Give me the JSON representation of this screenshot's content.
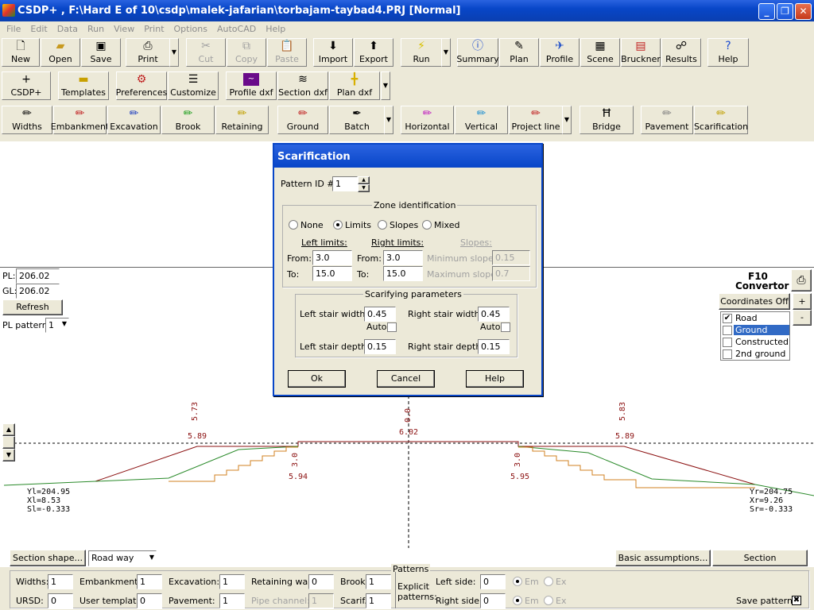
{
  "window": {
    "title": "CSDP+ , F:\\Hard E of 10\\csdp\\malek-jafarian\\torbajam-taybad4.PRJ [Normal]",
    "min": "_",
    "max": "❐",
    "close": "✕"
  },
  "menu": [
    "File",
    "Edit",
    "Data",
    "Run",
    "View",
    "Print",
    "Options",
    "AutoCAD",
    "Help"
  ],
  "toolbar1": {
    "new": "New",
    "open": "Open",
    "save": "Save",
    "print": "Print",
    "cut": "Cut",
    "copy": "Copy",
    "paste": "Paste",
    "import": "Import",
    "export": "Export",
    "run": "Run",
    "summary": "Summary",
    "plan": "Plan",
    "profile": "Profile",
    "scene": "Scene",
    "bruckner": "Bruckner",
    "results": "Results",
    "help": "Help"
  },
  "toolbar2": {
    "csdp": "CSDP+",
    "templates": "Templates",
    "preferences": "Preferences",
    "customize": "Customize",
    "profile_dxf": "Profile dxf",
    "section_dxf": "Section dxf",
    "plan_dxf": "Plan dxf"
  },
  "toolbar3": {
    "widths": "Widths",
    "embankment": "Embankment",
    "excavation": "Excavation",
    "brook": "Brook",
    "retaining": "Retaining",
    "ground": "Ground",
    "batch": "Batch",
    "horizontal": "Horizontal",
    "vertical": "Vertical",
    "project_line": "Project line",
    "bridge": "Bridge",
    "pavement": "Pavement",
    "scarification": "Scarification"
  },
  "leftpanel": {
    "pl_label": "PL:",
    "pl_value": "206.02",
    "gl_label": "GL:",
    "gl_value": "206.02",
    "refresh": "Refresh",
    "pl_pattern_label": "PL pattern:",
    "pl_pattern_value": "1"
  },
  "rightpanel": {
    "f10": "F10",
    "convertor": "Convertor",
    "coords": "Coordinates Off",
    "plus": "+",
    "minus": "-",
    "layers": [
      {
        "label": "Road",
        "checked": true
      },
      {
        "label": "Ground",
        "checked": false
      },
      {
        "label": "Constructed",
        "checked": false
      },
      {
        "label": "2nd ground",
        "checked": false
      }
    ]
  },
  "section": {
    "labels": {
      "l_top": "5.73",
      "l_bot": "5.89",
      "c_top": "0.0",
      "c_bot": "6.02",
      "r_top": "5.83",
      "r_bot": "5.89",
      "l_slope": "3.0",
      "l_slope_v": "5.94",
      "r_slope": "3.0",
      "r_slope_v": "5.95"
    },
    "left_info": [
      "Yl=204.95",
      "Xl=8.53",
      "Sl=-0.333"
    ],
    "right_info": [
      "Yr=204.75",
      "Xr=9.26",
      "Sr=-0.333"
    ]
  },
  "dialog": {
    "title": "Scarification",
    "pattern_label": "Pattern ID #",
    "pattern_value": "1",
    "zone_title": "Zone identification",
    "radios": [
      "None",
      "Limits",
      "Slopes",
      "Mixed"
    ],
    "left_limits": "Left limits:",
    "right_limits": "Right limits:",
    "slopes": "Slopes:",
    "from": "From:",
    "to": "To:",
    "left_from": "3.0",
    "left_to": "15.0",
    "right_from": "3.0",
    "right_to": "15.0",
    "min_slope_label": "Minimum slope:",
    "min_slope": "0.15",
    "max_slope_label": "Maximum slope:",
    "max_slope": "0.7",
    "scar_title": "Scarifying parameters",
    "lsw_label": "Left stair width:",
    "lsw": "0.45",
    "rsw_label": "Right stair width:",
    "rsw": "0.45",
    "auto": "Auto",
    "lsd_label": "Left stair depth:",
    "lsd": "0.15",
    "rsd_label": "Right stair depth:",
    "rsd": "0.15",
    "ok": "Ok",
    "cancel": "Cancel",
    "help": "Help"
  },
  "bottom": {
    "section_shape": "Section shape...",
    "roadway": "Road way",
    "basic": "Basic assumptions...",
    "section_info": "Section information...",
    "patterns": "Patterns",
    "widths": "Widths:",
    "widths_v": "1",
    "embankment": "Embankment:",
    "embankment_v": "1",
    "excavation": "Excavation:",
    "excavation_v": "1",
    "retaining": "Retaining wall:",
    "retaining_v": "0",
    "brook": "Brook:",
    "brook_v": "1",
    "ursd": "URSD:",
    "ursd_v": "0",
    "usertemplate": "User template:",
    "usertemplate_v": "0",
    "pavement": "Pavement:",
    "pavement_v": "1",
    "pipe": "Pipe channel:",
    "pipe_v": "1",
    "scarif": "Scarif.:",
    "scarif_v": "1",
    "explicit": "Explicit",
    "explicit2": "patterns:",
    "left_side": "Left side:",
    "left_side_v": "0",
    "right_side": "Right side:",
    "right_side_v": "0",
    "em": "Em",
    "ex": "Ex",
    "save_patterns": "Save patterns"
  }
}
